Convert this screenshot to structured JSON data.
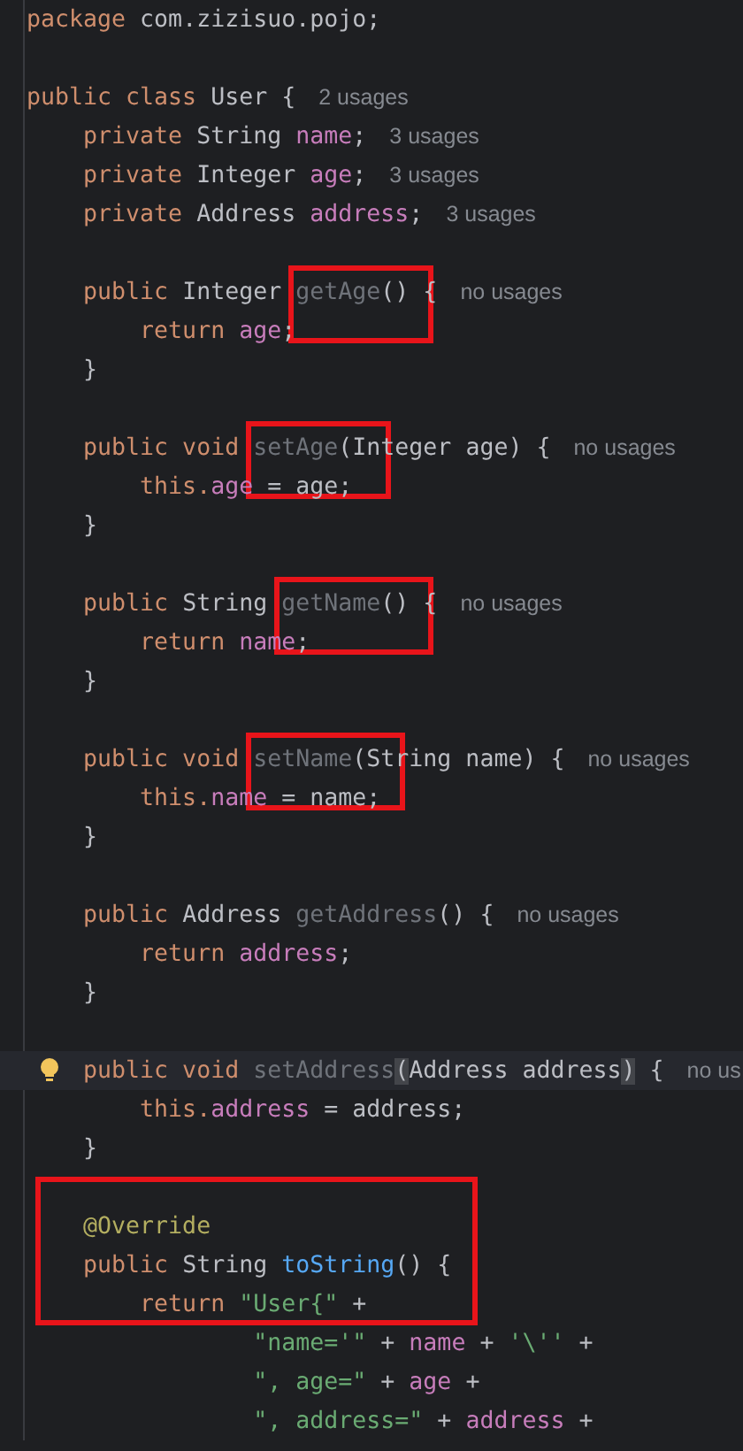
{
  "blocks": [
    {
      "lines": [
        {
          "tokens": [
            {
              "text": "package ",
              "kind": "kw"
            },
            {
              "text": "com.zizisuo.pojo;",
              "kind": "plain"
            }
          ]
        }
      ]
    },
    {
      "lines": [
        {
          "tokens": [
            {
              "text": "public class ",
              "kind": "kw"
            },
            {
              "text": "User {",
              "kind": "plain"
            }
          ],
          "hint": "2 usages"
        },
        {
          "tokens": [
            {
              "text": "    private ",
              "kind": "kw"
            },
            {
              "text": "String ",
              "kind": "plain"
            },
            {
              "text": "name",
              "kind": "field"
            },
            {
              "text": ";",
              "kind": "plain"
            }
          ],
          "hint": "3 usages"
        },
        {
          "tokens": [
            {
              "text": "    private ",
              "kind": "kw"
            },
            {
              "text": "Integer ",
              "kind": "plain"
            },
            {
              "text": "age",
              "kind": "field"
            },
            {
              "text": ";",
              "kind": "plain"
            }
          ],
          "hint": "3 usages"
        },
        {
          "tokens": [
            {
              "text": "    private ",
              "kind": "kw"
            },
            {
              "text": "Address ",
              "kind": "plain"
            },
            {
              "text": "address",
              "kind": "field"
            },
            {
              "text": ";",
              "kind": "plain"
            }
          ],
          "hint": "3 usages"
        }
      ]
    },
    {
      "lines": [
        {
          "tokens": [
            {
              "text": "    public ",
              "kind": "kw"
            },
            {
              "text": "Integer ",
              "kind": "plain"
            },
            {
              "text": "getAge",
              "kind": "unused",
              "boxed": true
            },
            {
              "text": "() {",
              "kind": "plain"
            }
          ],
          "hint": "no usages"
        },
        {
          "tokens": [
            {
              "text": "        return ",
              "kind": "kw"
            },
            {
              "text": "age",
              "kind": "field"
            },
            {
              "text": ";",
              "kind": "plain"
            }
          ]
        },
        {
          "tokens": [
            {
              "text": "    }",
              "kind": "plain"
            }
          ]
        }
      ]
    },
    {
      "lines": [
        {
          "tokens": [
            {
              "text": "    public void ",
              "kind": "kw"
            },
            {
              "text": "setAge",
              "kind": "unused",
              "boxed": true
            },
            {
              "text": "(Integer age) {",
              "kind": "plain"
            }
          ],
          "hint": "no usages"
        },
        {
          "tokens": [
            {
              "text": "        this.",
              "kind": "kw"
            },
            {
              "text": "age",
              "kind": "field"
            },
            {
              "text": " = age;",
              "kind": "plain"
            }
          ]
        },
        {
          "tokens": [
            {
              "text": "    }",
              "kind": "plain"
            }
          ]
        }
      ]
    },
    {
      "lines": [
        {
          "tokens": [
            {
              "text": "    public ",
              "kind": "kw"
            },
            {
              "text": "String ",
              "kind": "plain"
            },
            {
              "text": "getName",
              "kind": "unused",
              "boxed": true
            },
            {
              "text": "() {",
              "kind": "plain"
            }
          ],
          "hint": "no usages"
        },
        {
          "tokens": [
            {
              "text": "        return ",
              "kind": "kw"
            },
            {
              "text": "name",
              "kind": "field"
            },
            {
              "text": ";",
              "kind": "plain"
            }
          ]
        },
        {
          "tokens": [
            {
              "text": "    }",
              "kind": "plain"
            }
          ]
        }
      ]
    },
    {
      "lines": [
        {
          "tokens": [
            {
              "text": "    public void ",
              "kind": "kw"
            },
            {
              "text": "setName",
              "kind": "unused",
              "boxed": true
            },
            {
              "text": "(String name) {",
              "kind": "plain"
            }
          ],
          "hint": "no usages"
        },
        {
          "tokens": [
            {
              "text": "        this.",
              "kind": "kw"
            },
            {
              "text": "name",
              "kind": "field"
            },
            {
              "text": " = name;",
              "kind": "plain"
            }
          ]
        },
        {
          "tokens": [
            {
              "text": "    }",
              "kind": "plain"
            }
          ]
        }
      ]
    },
    {
      "lines": [
        {
          "tokens": [
            {
              "text": "    public ",
              "kind": "kw"
            },
            {
              "text": "Address ",
              "kind": "plain"
            },
            {
              "text": "getAddress",
              "kind": "unused"
            },
            {
              "text": "() {",
              "kind": "plain"
            }
          ],
          "hint": "no usages"
        },
        {
          "tokens": [
            {
              "text": "        return ",
              "kind": "kw"
            },
            {
              "text": "address",
              "kind": "field"
            },
            {
              "text": ";",
              "kind": "plain"
            }
          ]
        },
        {
          "tokens": [
            {
              "text": "    }",
              "kind": "plain"
            }
          ]
        }
      ]
    },
    {
      "lines": [
        {
          "tokens": [
            {
              "text": "    public void ",
              "kind": "kw"
            },
            {
              "text": "setAddress",
              "kind": "unused"
            },
            {
              "text": "(",
              "kind": "paren"
            },
            {
              "text": "Address address",
              "kind": "plain"
            },
            {
              "text": ")",
              "kind": "paren"
            },
            {
              "text": " {",
              "kind": "plain"
            }
          ],
          "hint": "no us",
          "current": true,
          "bulb": true
        },
        {
          "tokens": [
            {
              "text": "        this.",
              "kind": "kw"
            },
            {
              "text": "address",
              "kind": "field"
            },
            {
              "text": " = address;",
              "kind": "plain"
            }
          ]
        },
        {
          "tokens": [
            {
              "text": "    }",
              "kind": "plain"
            }
          ]
        }
      ]
    },
    {
      "lines": [
        {
          "tokens": [
            {
              "text": "    @Override",
              "kind": "annotation"
            }
          ],
          "boxed": true
        },
        {
          "tokens": [
            {
              "text": "    public ",
              "kind": "kw"
            },
            {
              "text": "String ",
              "kind": "plain"
            },
            {
              "text": "toString",
              "kind": "method"
            },
            {
              "text": "() {",
              "kind": "plain"
            }
          ],
          "boxed": true
        },
        {
          "tokens": [
            {
              "text": "        return ",
              "kind": "kw"
            },
            {
              "text": "\"User{\"",
              "kind": "string"
            },
            {
              "text": " +",
              "kind": "plain"
            }
          ],
          "boxed": true
        },
        {
          "tokens": [
            {
              "text": "                \"name='\"",
              "kind": "string"
            },
            {
              "text": " + ",
              "kind": "plain"
            },
            {
              "text": "name",
              "kind": "field"
            },
            {
              "text": " + ",
              "kind": "plain"
            },
            {
              "text": "'\\''",
              "kind": "string"
            },
            {
              "text": " +",
              "kind": "plain"
            }
          ]
        },
        {
          "tokens": [
            {
              "text": "                \", age=\"",
              "kind": "string"
            },
            {
              "text": " + ",
              "kind": "plain"
            },
            {
              "text": "age",
              "kind": "field"
            },
            {
              "text": " +",
              "kind": "plain"
            }
          ]
        },
        {
          "tokens": [
            {
              "text": "                \", address=\"",
              "kind": "string"
            },
            {
              "text": " + ",
              "kind": "plain"
            },
            {
              "text": "address",
              "kind": "field"
            },
            {
              "text": " +",
              "kind": "plain"
            }
          ]
        }
      ]
    }
  ]
}
